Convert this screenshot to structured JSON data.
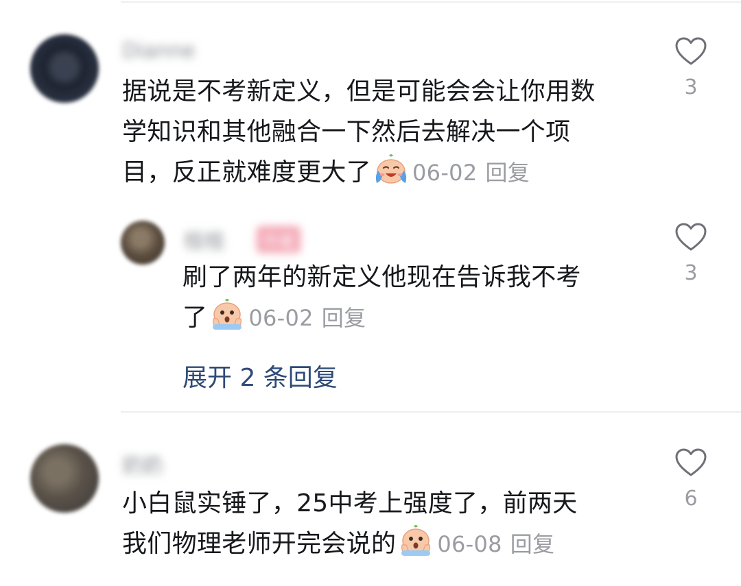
{
  "comments": [
    {
      "username": "Dianne",
      "text": "据说是不考新定义，但是可能会会让你用数学知识和其他融合一下然后去解决一个项目，反正就难度更大了",
      "lines": [
        "据说是不考新定义，但是可能会会让你用数",
        "学知识和其他融合一下然后去解决一个项",
        "目，反正就难度更大了"
      ],
      "emoji": "laughing-tears-emoji",
      "date": "06-02",
      "reply_label": "回复",
      "likes": "3"
    },
    {
      "username": "桂桂",
      "badge": "作者",
      "lines": [
        "刷了两年的新定义他现在告诉我不考",
        "了"
      ],
      "emoji": "scared-emoji",
      "date": "06-02",
      "reply_label": "回复",
      "likes": "3"
    },
    {
      "username": "奶奶",
      "lines": [
        "小白鼠实锤了，25中考上强度了，前两天",
        "我们物理老师开完会说的"
      ],
      "emoji": "scared-emoji",
      "date": "06-08",
      "reply_label": "回复",
      "likes": "6"
    }
  ],
  "expand_replies": "展开 2 条回复",
  "icons": {
    "like": "heart-outline-icon"
  },
  "colors": {
    "link": "#2e4a78",
    "meta": "#9a9ca2",
    "text": "#17181c"
  }
}
